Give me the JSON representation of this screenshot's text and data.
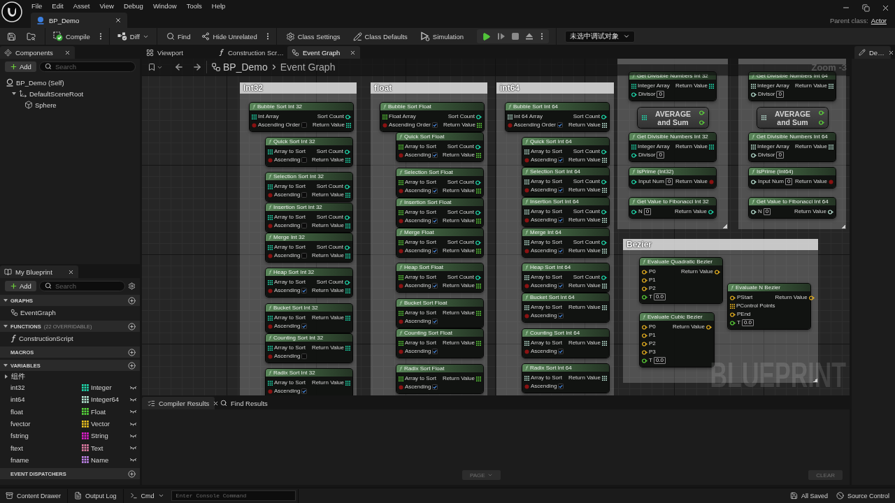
{
  "title_bar": {
    "menu": [
      "File",
      "Edit",
      "Asset",
      "View",
      "Debug",
      "Window",
      "Tools",
      "Help"
    ],
    "asset_tab": "BP_Demo",
    "parent_class_label": "Parent class:",
    "parent_class": "Actor"
  },
  "toolbar": {
    "compile": "Compile",
    "diff": "Diff",
    "find": "Find",
    "hide_unrelated": "Hide Unrelated",
    "class_settings": "Class Settings",
    "class_defaults": "Class Defaults",
    "simulation": "Simulation",
    "debug_object": "未选中调试对象"
  },
  "components": {
    "tab": "Components",
    "add": "Add",
    "search_placeholder": "Search",
    "tree": [
      {
        "label": "BP_Demo (Self)",
        "children": [
          {
            "label": "DefaultSceneRoot",
            "expanded": true,
            "children": [
              {
                "label": "Sphere"
              }
            ]
          }
        ]
      }
    ]
  },
  "my_blueprint": {
    "tab": "My Blueprint",
    "add": "Add",
    "search_placeholder": "Search",
    "sections": [
      {
        "title": "GRAPHS",
        "expanded": true,
        "items": [
          {
            "kind": "graph",
            "label": "EventGraph"
          }
        ]
      },
      {
        "title": "FUNCTIONS",
        "note": "(22 OVERRIDABLE)",
        "expanded": true,
        "items": [
          {
            "kind": "function",
            "label": "ConstructionScript"
          }
        ]
      },
      {
        "title": "MACROS",
        "expanded": false
      },
      {
        "title": "VARIABLES",
        "expanded": true,
        "categories": [
          {
            "label": "组件",
            "expanded": false
          }
        ],
        "items": [
          {
            "kind": "variable",
            "label": "int32",
            "type": "Integer",
            "color": "#1fdfb1"
          },
          {
            "kind": "variable",
            "label": "int64",
            "type": "Integer64",
            "color": "#b8ecd8"
          },
          {
            "kind": "variable",
            "label": "float",
            "type": "Float",
            "color": "#58dc3c"
          },
          {
            "kind": "variable",
            "label": "fvector",
            "type": "Vector",
            "color": "#f4c81e"
          },
          {
            "kind": "variable",
            "label": "fstring",
            "type": "String",
            "color": "#e61fd2"
          },
          {
            "kind": "variable",
            "label": "ftext",
            "type": "Text",
            "color": "#e67fa8"
          },
          {
            "kind": "variable",
            "label": "fname",
            "type": "Name",
            "color": "#c688f2"
          }
        ]
      },
      {
        "title": "EVENT DISPATCHERS",
        "expanded": false
      }
    ]
  },
  "document_tabs": [
    {
      "label": "Viewport",
      "selected": false
    },
    {
      "label": "Construction Scr…",
      "selected": false
    },
    {
      "label": "Event Graph",
      "selected": true
    }
  ],
  "graph": {
    "breadcrumb": [
      "BP_Demo",
      "Event Graph"
    ],
    "zoom_label": "Zoom -3",
    "watermark": "BLUEPRINT",
    "comments": [
      {
        "title": "Int32",
        "nodes": [
          {
            "kind": "function",
            "title": "Bubble Sort Int 32",
            "inputs": [
              {
                "kind": "int32-array",
                "label": "Int Array"
              },
              {
                "kind": "bool",
                "label": "Ascending Order",
                "checked": false
              }
            ],
            "outputs": [
              {
                "kind": "int32",
                "label": "Sort Count"
              },
              {
                "kind": "int32-array",
                "label": "Return Value"
              }
            ]
          },
          {
            "kind": "function",
            "title": "Quick Sort Int 32",
            "inputs": [
              {
                "kind": "int32-array",
                "label": "Array to Sort"
              },
              {
                "kind": "bool",
                "label": "Ascending",
                "checked": false
              }
            ],
            "outputs": [
              {
                "kind": "int32",
                "label": "Sort Count"
              },
              {
                "kind": "int32-array",
                "label": "Return Value"
              }
            ]
          },
          {
            "kind": "function",
            "title": "Selection Sort Int 32",
            "inputs": [
              {
                "kind": "int32-array",
                "label": "Array to Sort"
              },
              {
                "kind": "bool",
                "label": "Ascending",
                "checked": false
              }
            ],
            "outputs": [
              {
                "kind": "int32",
                "label": "Sort Count"
              },
              {
                "kind": "int32-array",
                "label": "Return Value"
              }
            ]
          },
          {
            "kind": "function",
            "title": "Insertion Sort Int 32",
            "inputs": [
              {
                "kind": "int32-array",
                "label": "Array to Sort"
              },
              {
                "kind": "bool",
                "label": "Ascending",
                "checked": false
              }
            ],
            "outputs": [
              {
                "kind": "int32",
                "label": "Sort Count"
              },
              {
                "kind": "int32-array",
                "label": "Return Value"
              }
            ]
          },
          {
            "kind": "function",
            "title": "Merge Int 32",
            "inputs": [
              {
                "kind": "int32-array",
                "label": "Array to Sort"
              },
              {
                "kind": "bool",
                "label": "Ascending",
                "checked": false
              }
            ],
            "outputs": [
              {
                "kind": "int32",
                "label": "Sort Count"
              },
              {
                "kind": "int32-array",
                "label": "Return Value"
              }
            ]
          },
          {
            "kind": "function",
            "title": "Heap Sort Int 32",
            "inputs": [
              {
                "kind": "int32-array",
                "label": "Array to Sort"
              },
              {
                "kind": "bool",
                "label": "Ascending",
                "checked": true
              }
            ],
            "outputs": [
              {
                "kind": "int32",
                "label": "Sort Count"
              },
              {
                "kind": "int32-array",
                "label": "Return Value"
              }
            ]
          },
          {
            "kind": "function",
            "title": "Bucket Sort Int 32",
            "inputs": [
              {
                "kind": "int32-array",
                "label": "Array to Sort"
              },
              {
                "kind": "bool",
                "label": "Ascending",
                "checked": true
              }
            ],
            "outputs": [
              {
                "kind": "int32-array",
                "label": "Return Value"
              }
            ]
          },
          {
            "kind": "function",
            "title": "Counting Sort Int 32",
            "inputs": [
              {
                "kind": "int32-array",
                "label": "Array to Sort"
              },
              {
                "kind": "bool",
                "label": "Ascending",
                "checked": false
              }
            ],
            "outputs": [
              {
                "kind": "int32-array",
                "label": "Return Value"
              }
            ]
          },
          {
            "kind": "function",
            "title": "Radix Sort Int 32",
            "inputs": [
              {
                "kind": "int32-array",
                "label": "Array to Sort"
              },
              {
                "kind": "bool",
                "label": "Ascending",
                "checked": true
              }
            ],
            "outputs": [
              {
                "kind": "int32-array",
                "label": "Return Value"
              }
            ]
          }
        ]
      },
      {
        "title": "float",
        "nodes": [
          {
            "kind": "function",
            "title": "Bubble Sort Float",
            "inputs": [
              {
                "kind": "float-array",
                "label": "Float Array"
              },
              {
                "kind": "bool",
                "label": "Ascending Order",
                "checked": true
              }
            ],
            "outputs": [
              {
                "kind": "int32",
                "label": "Sort Count"
              },
              {
                "kind": "float-array",
                "label": "Return Value"
              }
            ]
          },
          {
            "kind": "function",
            "title": "Quick Sort Float",
            "inputs": [
              {
                "kind": "float-array",
                "label": "Array to Sort"
              },
              {
                "kind": "bool",
                "label": "Ascending",
                "checked": true
              }
            ],
            "outputs": [
              {
                "kind": "int32",
                "label": "Sort Count"
              },
              {
                "kind": "float-array",
                "label": "Return Value"
              }
            ]
          },
          {
            "kind": "function",
            "title": "Selection Sort Float",
            "inputs": [
              {
                "kind": "float-array",
                "label": "Array to Sort"
              },
              {
                "kind": "bool",
                "label": "Ascending",
                "checked": true
              }
            ],
            "outputs": [
              {
                "kind": "int32",
                "label": "Sort Count"
              },
              {
                "kind": "float-array",
                "label": "Return Value"
              }
            ]
          },
          {
            "kind": "function",
            "title": "Insertion Sort Float",
            "inputs": [
              {
                "kind": "float-array",
                "label": "Array to Sort"
              },
              {
                "kind": "bool",
                "label": "Ascending",
                "checked": true
              }
            ],
            "outputs": [
              {
                "kind": "int32",
                "label": "Sort Count"
              },
              {
                "kind": "float-array",
                "label": "Return Value"
              }
            ]
          },
          {
            "kind": "function",
            "title": "Merge Float",
            "inputs": [
              {
                "kind": "float-array",
                "label": "Array to Sort"
              },
              {
                "kind": "bool",
                "label": "Ascending",
                "checked": true
              }
            ],
            "outputs": [
              {
                "kind": "int32",
                "label": "Sort Count"
              },
              {
                "kind": "float-array",
                "label": "Return Value"
              }
            ]
          },
          {
            "kind": "function",
            "title": "Heap Sort Float",
            "inputs": [
              {
                "kind": "float-array",
                "label": "Array to Sort"
              },
              {
                "kind": "bool",
                "label": "Ascending",
                "checked": true
              }
            ],
            "outputs": [
              {
                "kind": "int32",
                "label": "Sort Count"
              },
              {
                "kind": "float-array",
                "label": "Return Value"
              }
            ]
          },
          {
            "kind": "function",
            "title": "Bucket Sort Float",
            "inputs": [
              {
                "kind": "float-array",
                "label": "Array to Sort"
              },
              {
                "kind": "bool",
                "label": "Ascending",
                "checked": true
              }
            ],
            "outputs": [
              {
                "kind": "float-array",
                "label": "Return Value"
              }
            ]
          },
          {
            "kind": "function",
            "title": "Counting Sort Float",
            "inputs": [
              {
                "kind": "float-array",
                "label": "Array to Sort"
              },
              {
                "kind": "bool",
                "label": "Ascending",
                "checked": true
              }
            ],
            "outputs": [
              {
                "kind": "float-array",
                "label": "Return Value"
              }
            ]
          },
          {
            "kind": "function",
            "title": "Radix Sort Float",
            "inputs": [
              {
                "kind": "float-array",
                "label": "Array to Sort"
              },
              {
                "kind": "bool",
                "label": "Ascending",
                "checked": true
              }
            ],
            "outputs": [
              {
                "kind": "float-array",
                "label": "Return Value"
              }
            ]
          }
        ]
      },
      {
        "title": "int64",
        "nodes": [
          {
            "kind": "function",
            "title": "Bubble Sort Int 64",
            "inputs": [
              {
                "kind": "int64-array",
                "label": "Int 64 Array"
              },
              {
                "kind": "bool",
                "label": "Ascending Order",
                "checked": true
              }
            ],
            "outputs": [
              {
                "kind": "int32",
                "label": "Sort Count"
              },
              {
                "kind": "int64-array",
                "label": "Return Value"
              }
            ]
          },
          {
            "kind": "function",
            "title": "Quick Sort Int 64",
            "inputs": [
              {
                "kind": "int64-array",
                "label": "Array to Sort"
              },
              {
                "kind": "bool",
                "label": "Ascending",
                "checked": true
              }
            ],
            "outputs": [
              {
                "kind": "int32",
                "label": "Sort Count"
              },
              {
                "kind": "int64-array",
                "label": "Return Value"
              }
            ]
          },
          {
            "kind": "function",
            "title": "Selection Sort Int 64",
            "inputs": [
              {
                "kind": "int64-array",
                "label": "Array to Sort"
              },
              {
                "kind": "bool",
                "label": "Ascending",
                "checked": true
              }
            ],
            "outputs": [
              {
                "kind": "int32",
                "label": "Sort Count"
              },
              {
                "kind": "int64-array",
                "label": "Return Value"
              }
            ]
          },
          {
            "kind": "function",
            "title": "Insertion Sort Int 64",
            "inputs": [
              {
                "kind": "int64-array",
                "label": "Array to Sort"
              },
              {
                "kind": "bool",
                "label": "Ascending",
                "checked": true
              }
            ],
            "outputs": [
              {
                "kind": "int32",
                "label": "Sort Count"
              },
              {
                "kind": "int64-array",
                "label": "Return Value"
              }
            ]
          },
          {
            "kind": "function",
            "title": "Merge Int 64",
            "inputs": [
              {
                "kind": "int64-array",
                "label": "Array to Sort"
              },
              {
                "kind": "bool",
                "label": "Ascending",
                "checked": true
              }
            ],
            "outputs": [
              {
                "kind": "int32",
                "label": "Sort Count"
              },
              {
                "kind": "int64-array",
                "label": "Return Value"
              }
            ]
          },
          {
            "kind": "function",
            "title": "Heap Sort Int 64",
            "inputs": [
              {
                "kind": "int64-array",
                "label": "Array to Sort"
              },
              {
                "kind": "bool",
                "label": "Ascending",
                "checked": true
              }
            ],
            "outputs": [
              {
                "kind": "int32",
                "label": "Sort Count"
              },
              {
                "kind": "int64-array",
                "label": "Return Value"
              }
            ]
          },
          {
            "kind": "function",
            "title": "Bucket Sort Int 64",
            "inputs": [
              {
                "kind": "int64-array",
                "label": "Array to Sort"
              },
              {
                "kind": "bool",
                "label": "Ascending",
                "checked": true
              }
            ],
            "outputs": [
              {
                "kind": "int64-array",
                "label": "Return Value"
              }
            ]
          },
          {
            "kind": "function",
            "title": "Counting Sort Int 64",
            "inputs": [
              {
                "kind": "int64-array",
                "label": "Array to Sort"
              },
              {
                "kind": "bool",
                "label": "Ascending",
                "checked": true
              }
            ],
            "outputs": [
              {
                "kind": "int64-array",
                "label": "Return Value"
              }
            ]
          },
          {
            "kind": "function",
            "title": "Radix Sort Int 64",
            "inputs": [
              {
                "kind": "int64-array",
                "label": "Array to Sort"
              },
              {
                "kind": "bool",
                "label": "Ascending",
                "checked": true
              }
            ],
            "outputs": [
              {
                "kind": "int64-array",
                "label": "Return Value"
              }
            ]
          }
        ]
      },
      {
        "nodes": [
          {
            "kind": "function",
            "title": "Get Divisible Numbers Int 32",
            "inputs": [
              {
                "kind": "int32-array",
                "label": "Integer Array"
              },
              {
                "kind": "int32",
                "label": "Divisor",
                "value": "0"
              }
            ],
            "outputs": [
              {
                "kind": "int32-array",
                "label": "Return Value"
              }
            ]
          },
          {
            "kind": "macro",
            "title": "AVERAGE and Sum",
            "inputs": [
              {
                "kind": "int32-array"
              }
            ],
            "outputs": [
              {
                "kind": "float"
              },
              {
                "kind": "float"
              }
            ]
          },
          {
            "kind": "function",
            "title": "Get Divisible Numbers Int 32",
            "inputs": [
              {
                "kind": "int32-array",
                "label": "Integer Array"
              },
              {
                "kind": "int32",
                "label": "Divisor",
                "value": "0"
              }
            ],
            "outputs": [
              {
                "kind": "int32-array",
                "label": "Return Value"
              }
            ]
          },
          {
            "kind": "function",
            "title": "IsPrime (Int32)",
            "inputs": [
              {
                "kind": "int32",
                "label": "Input Num",
                "value": "0"
              }
            ],
            "outputs": [
              {
                "kind": "bool",
                "label": "Return Value"
              }
            ]
          },
          {
            "kind": "function",
            "title": "Get Value to Fibonacci Int 32",
            "inputs": [
              {
                "kind": "int32",
                "label": "N",
                "value": "0"
              }
            ],
            "outputs": [
              {
                "kind": "int32",
                "label": "Return Value"
              }
            ]
          }
        ]
      },
      {
        "nodes": [
          {
            "kind": "function",
            "title": "Get Divisible Numbers Int 64",
            "inputs": [
              {
                "kind": "int64-array",
                "label": "Integer Array"
              },
              {
                "kind": "int64",
                "label": "Divisor",
                "value": "0"
              }
            ],
            "outputs": [
              {
                "kind": "int64-array",
                "label": "Return Value"
              }
            ]
          },
          {
            "kind": "macro",
            "title": "AVERAGE and Sum",
            "inputs": [
              {
                "kind": "int64-array"
              }
            ],
            "outputs": [
              {
                "kind": "float"
              },
              {
                "kind": "float"
              }
            ]
          },
          {
            "kind": "function",
            "title": "Get Divisible Numbers Int 64",
            "inputs": [
              {
                "kind": "int64-array",
                "label": "Integer Array"
              },
              {
                "kind": "int64",
                "label": "Divisor",
                "value": "0"
              }
            ],
            "outputs": [
              {
                "kind": "int64-array",
                "label": "Return Value"
              }
            ]
          },
          {
            "kind": "function",
            "title": "IsPrime (Int64)",
            "inputs": [
              {
                "kind": "int64",
                "label": "Input Num",
                "value": "0"
              }
            ],
            "outputs": [
              {
                "kind": "bool",
                "label": "Return Value"
              }
            ]
          },
          {
            "kind": "function",
            "title": "Get Value to Fibonacci Int 64",
            "inputs": [
              {
                "kind": "int64",
                "label": "N",
                "value": "0"
              }
            ],
            "outputs": [
              {
                "kind": "int64",
                "label": "Return Value"
              }
            ]
          }
        ]
      },
      {
        "title": "Bezier",
        "nodes": [
          {
            "kind": "function",
            "title": "Evaluate Quadratic Bezier",
            "inputs": [
              {
                "kind": "vector",
                "label": "P0"
              },
              {
                "kind": "vector",
                "label": "P1"
              },
              {
                "kind": "vector",
                "label": "P2"
              },
              {
                "kind": "float",
                "label": "T",
                "value": "0.0"
              }
            ],
            "outputs": [
              {
                "kind": "vector",
                "label": "Return Value"
              }
            ]
          },
          {
            "kind": "function",
            "title": "Evaluate Cubic Bezier",
            "inputs": [
              {
                "kind": "vector",
                "label": "P0"
              },
              {
                "kind": "vector",
                "label": "P1"
              },
              {
                "kind": "vector",
                "label": "P2"
              },
              {
                "kind": "vector",
                "label": "P3"
              },
              {
                "kind": "float",
                "label": "T",
                "value": "0.0"
              }
            ],
            "outputs": [
              {
                "kind": "vector",
                "label": "Return Value"
              }
            ]
          },
          {
            "kind": "function",
            "title": "Evaluate N Bezier",
            "inputs": [
              {
                "kind": "vector",
                "label": "PStart"
              },
              {
                "kind": "vector-array",
                "label": "PControl Points"
              },
              {
                "kind": "vector",
                "label": "PEnd"
              },
              {
                "kind": "float",
                "label": "T",
                "value": "0.0"
              }
            ],
            "outputs": [
              {
                "kind": "vector",
                "label": "Return Value"
              }
            ]
          }
        ]
      }
    ]
  },
  "compiler_results": {
    "tabs": [
      {
        "label": "Compiler Results",
        "selected": true
      },
      {
        "label": "Find Results",
        "selected": false
      }
    ],
    "page_button": {
      "label": "PAGE",
      "disabled": true
    },
    "clear_button": {
      "label": "CLEAR",
      "disabled": true
    }
  },
  "details": {
    "tab": "De…"
  },
  "status_bar": {
    "content_drawer": "Content Drawer",
    "output_log": "Output Log",
    "cmd": "Cmd",
    "console_placeholder": "Enter Console Command",
    "saved": "All Saved",
    "source_control": "Source Control"
  }
}
